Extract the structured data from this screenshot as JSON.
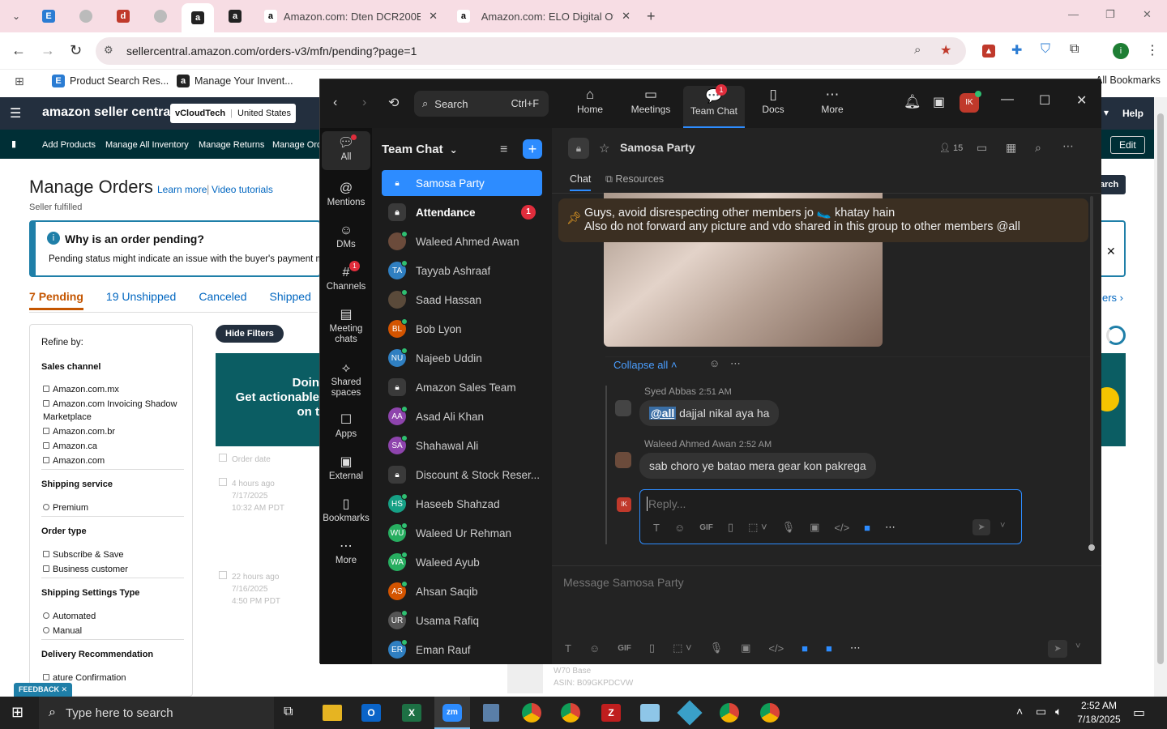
{
  "browser": {
    "tabs": [
      {
        "label": "Amazon.com: Dten DCR200EA"
      },
      {
        "label": "Amazon.com: ELO Digital Office"
      }
    ],
    "url": "sellercentral.amazon.com/orders-v3/mfn/pending?page=1",
    "bookmarks": [
      "Product Search Res...",
      "Manage Your Invent...",
      "All Bookmarks"
    ]
  },
  "amazon": {
    "logo": "amazon seller central",
    "store": "vCloudTech",
    "marketplace": "United States",
    "help": "Help",
    "nav": [
      "Add Products",
      "Manage All Inventory",
      "Manage Returns",
      "Manage Ord"
    ],
    "edit": "Edit",
    "page_title": "Manage Orders",
    "learn_more": "Learn more",
    "video_tutorials": "Video tutorials",
    "subtitle": "Seller fulfilled",
    "pending_title": "Why is an order pending?",
    "pending_body": "Pending status might indicate an issue with the buyer's payment m",
    "status_tabs": [
      {
        "count": "7",
        "label": "Pending"
      },
      {
        "count": "19",
        "label": "Unshipped"
      },
      {
        "count": "",
        "label": "Canceled"
      },
      {
        "count": "",
        "label": "Shipped"
      }
    ],
    "refine": "Refine by:",
    "hide_filters": "Hide Filters",
    "search_btn": "arch",
    "filters": [
      {
        "heading": "Sales channel",
        "options": [
          "Amazon.com.mx",
          "Amazon.com Invoicing Shadow Marketplace",
          "Amazon.com.br",
          "Amazon.ca",
          "Amazon.com"
        ]
      },
      {
        "heading": "Shipping service",
        "options": [
          "Premium"
        ]
      },
      {
        "heading": "Order type",
        "options": [
          "Subscribe & Save",
          "Business customer"
        ]
      },
      {
        "heading": "Shipping Settings Type",
        "options": [
          "Automated",
          "Manual"
        ]
      },
      {
        "heading": "Delivery Recommendation",
        "options": [
          "ature Confirmation"
        ]
      }
    ],
    "banner_lines": [
      "Doin",
      "Get actionable",
      "on t"
    ],
    "order_date_col": "Order date",
    "orders": [
      {
        "ago": "4 hours ago",
        "date": "7/17/2025",
        "time": "10:32 AM PDT"
      },
      {
        "ago": "22 hours ago",
        "date": "7/16/2025",
        "time": "4:50 PM PDT"
      }
    ],
    "feedback": "FEEDBACK",
    "product_line1": "W70 Base",
    "product_line2": "ASIN: B09GKPDCVW",
    "right_link": "ers"
  },
  "zoom": {
    "search_label": "Search",
    "search_shortcut": "Ctrl+F",
    "top_tabs": [
      {
        "label": "Home",
        "icon": "home-icon"
      },
      {
        "label": "Meetings",
        "icon": "camera-icon"
      },
      {
        "label": "Team Chat",
        "icon": "chat-icon",
        "badge": "1"
      },
      {
        "label": "Docs",
        "icon": "doc-icon"
      },
      {
        "label": "More",
        "icon": "more-icon"
      }
    ],
    "user_initials": "IK",
    "rail": [
      {
        "label": "All"
      },
      {
        "label": "Mentions"
      },
      {
        "label": "DMs"
      },
      {
        "label": "Channels",
        "badge": "1"
      },
      {
        "label": "Meeting chats"
      },
      {
        "label": "Shared spaces"
      },
      {
        "label": "Apps"
      },
      {
        "label": "External"
      },
      {
        "label": "Bookmarks"
      },
      {
        "label": "More"
      }
    ],
    "list_title": "Team Chat",
    "chats": [
      {
        "name": "Samosa Party",
        "type": "lock",
        "active": true
      },
      {
        "name": "Attendance",
        "type": "lock",
        "bold": true,
        "badge": "1"
      },
      {
        "name": "Waleed Ahmed Awan",
        "type": "photo",
        "color": "#6b4b3b"
      },
      {
        "name": "Tayyab Ashraaf",
        "initials": "TA",
        "color": "#2f7fc1"
      },
      {
        "name": "Saad Hassan",
        "type": "photo",
        "color": "#5a4a3a"
      },
      {
        "name": "Bob Lyon",
        "initials": "BL",
        "color": "#d35400"
      },
      {
        "name": "Najeeb Uddin",
        "initials": "NU",
        "color": "#2f7fc1"
      },
      {
        "name": "Amazon Sales Team",
        "type": "lock"
      },
      {
        "name": "Asad Ali Khan",
        "initials": "AA",
        "color": "#8e44ad"
      },
      {
        "name": "Shahawal Ali",
        "initials": "SA",
        "color": "#8e44ad"
      },
      {
        "name": "Discount & Stock Reser...",
        "type": "lock"
      },
      {
        "name": "Haseeb Shahzad",
        "initials": "HS",
        "color": "#16a085"
      },
      {
        "name": "Waleed Ur Rehman",
        "initials": "WU",
        "color": "#27ae60"
      },
      {
        "name": "Waleed Ayub",
        "initials": "WA",
        "color": "#27ae60"
      },
      {
        "name": "Ahsan Saqib",
        "initials": "AS",
        "color": "#d35400"
      },
      {
        "name": "Usama Rafiq",
        "initials": "UR",
        "color": "#555"
      },
      {
        "name": "Eman Rauf",
        "initials": "ER",
        "color": "#2f7fc1"
      }
    ],
    "channel_name": "Samosa Party",
    "member_count": "15",
    "main_tabs": [
      "Chat",
      "Resources"
    ],
    "pinned_line1": "Guys, avoid disrespecting other members jo 🥿 khatay hain",
    "pinned_line2": "Also do not forward any picture and vdo shared in this group to other members @all",
    "collapse": "Collapse all",
    "messages": [
      {
        "sender": "Syed Abbas",
        "time": "2:51 AM",
        "mention": "@all",
        "text": " dajjal nikal aya ha"
      },
      {
        "sender": "Waleed Ahmed Awan",
        "time": "2:52 AM",
        "mention": "",
        "text": "sab choro ye batao mera gear kon pakrega"
      }
    ],
    "reply_placeholder": "Reply...",
    "compose_placeholder": "Message Samosa Party",
    "gif": "GIF"
  },
  "taskbar": {
    "search_placeholder": "Type here to search",
    "time": "2:52 AM",
    "date": "7/18/2025"
  }
}
